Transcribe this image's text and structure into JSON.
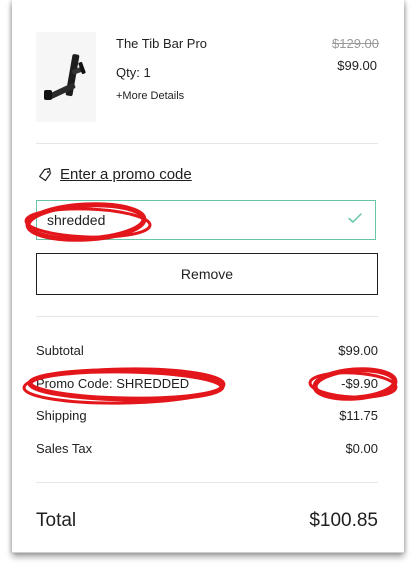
{
  "cart_item": {
    "name": "The Tib Bar Pro",
    "qty_text": "Qty: 1",
    "details_link": "+More Details",
    "original_price": "$129.00",
    "sale_price": "$99.00",
    "image_icon": "tib-bar-product-icon"
  },
  "promo": {
    "link_label": "Enter a promo code",
    "tag_icon": "tag-icon",
    "code_value": "shredded",
    "valid_icon": "check-icon",
    "remove_label": "Remove"
  },
  "summary": {
    "subtotal_label": "Subtotal",
    "subtotal_value": "$99.00",
    "promo_label": "Promo Code: SHREDDED",
    "promo_value": "-$9.90",
    "shipping_label": "Shipping",
    "shipping_value": "$11.75",
    "tax_label": "Sales Tax",
    "tax_value": "$0.00",
    "total_label": "Total",
    "total_value": "$100.85"
  },
  "colors": {
    "annotation": "#e3161b",
    "input_border_valid": "#67c5a8",
    "strike_price": "#9b9b9b"
  }
}
